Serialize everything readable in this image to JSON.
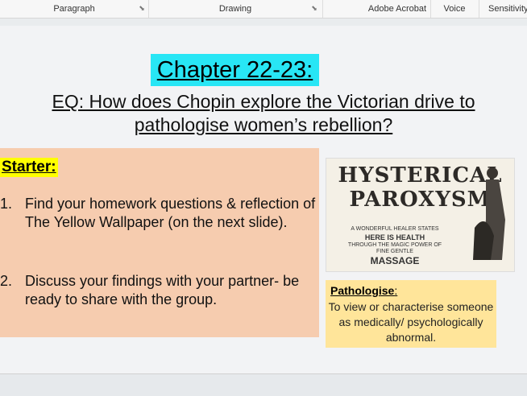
{
  "ribbon": {
    "groups": [
      "Paragraph",
      "Drawing",
      "Adobe Acrobat",
      "Voice",
      "Sensitivity"
    ]
  },
  "slide": {
    "title": "Chapter 22-23:",
    "eq_line1": "EQ: How does Chopin explore the Victorian drive to",
    "eq_line2": "pathologise women’s rebellion?",
    "starter": {
      "label": "Starter:",
      "items": [
        {
          "num": "1.",
          "text": "Find your homework questions & reflection of The Yellow Wallpaper (on the next slide)."
        },
        {
          "num": "2.",
          "text": "Discuss your findings with your partner- be ready to share with the group."
        }
      ]
    },
    "image": {
      "line1": "HYSTERICAL",
      "line2": "PAROXYSM",
      "small1": "A WONDERFUL HEALER STATES",
      "small2": "HERE IS HEALTH",
      "small3": "THROUGH THE MAGIC POWER OF",
      "small4": "FINE GENTLE",
      "small5": "MASSAGE"
    },
    "definition": {
      "term": "Pathologise",
      "colon": ":",
      "text": "To view or characterise someone as medically/ psychologically abnormal."
    }
  }
}
